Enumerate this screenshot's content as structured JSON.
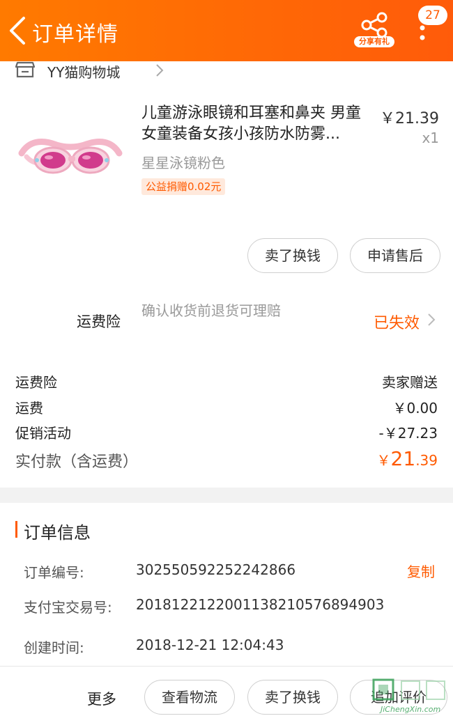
{
  "header": {
    "title": "订单详情",
    "share_label": "分享有礼",
    "message_count": "27"
  },
  "shop": {
    "name": "YY猫购物城"
  },
  "product": {
    "title": "儿童游泳眼镜和耳塞和鼻夹 男童女童装备女孩小孩防水防雾...",
    "price": "￥21.39",
    "quantity": "x1",
    "sku": "星星泳镜粉色",
    "charity_tag": "公益捐赠0.02元"
  },
  "item_actions": {
    "sell_label": "卖了换钱",
    "after_sale_label": "申请售后"
  },
  "insurance": {
    "label": "运费险",
    "description": "确认收货前退货可理赔",
    "status": "已失效"
  },
  "fees": [
    {
      "label": "运费险",
      "value": "卖家赠送"
    },
    {
      "label": "运费",
      "value": "￥0.00"
    },
    {
      "label": "促销活动",
      "value": "-￥27.23"
    }
  ],
  "paid": {
    "label": "实付款（含运费）",
    "currency": "￥",
    "integer": "21",
    "decimal": ".39"
  },
  "order_info": {
    "title": "订单信息",
    "copy_label": "复制",
    "rows": [
      {
        "label": "订单编号:",
        "value": "302550592252242866"
      },
      {
        "label": "支付宝交易号:",
        "value": "2018122122001138210576894903"
      },
      {
        "label": "创建时间:",
        "value": "2018-12-21 12:04:43"
      }
    ]
  },
  "bottom_bar": {
    "more_label": "更多",
    "logistics_label": "查看物流",
    "sell_label": "卖了换钱",
    "review_label": "追加评价"
  },
  "watermark": {
    "text": "JiChengXin.com"
  },
  "colors": {
    "accent": "#ff5a00",
    "header_start": "#ff7a00",
    "header_end": "#ff5b0a"
  }
}
